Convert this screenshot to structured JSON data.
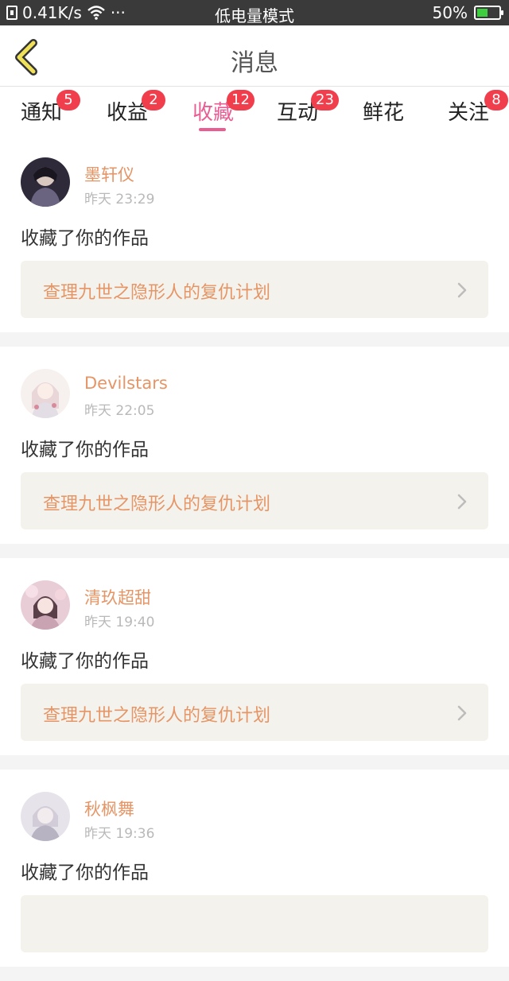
{
  "status_bar": {
    "speed": "0.41K/s",
    "more": "···",
    "mode": "低电量模式",
    "battery_percent": "50%",
    "battery_level": 0.5
  },
  "header": {
    "title": "消息",
    "back_icon": "chevron-left-icon",
    "accent_color": "#f0e15a"
  },
  "tabs": [
    {
      "label": "通知",
      "badge": "5",
      "active": false
    },
    {
      "label": "收益",
      "badge": "2",
      "active": false
    },
    {
      "label": "收藏",
      "badge": "12",
      "active": true
    },
    {
      "label": "互动",
      "badge": "23",
      "active": false
    },
    {
      "label": "鲜花",
      "badge": "",
      "active": false
    },
    {
      "label": "关注",
      "badge": "8",
      "active": false
    }
  ],
  "colors": {
    "active_tab": "#e95d93",
    "badge": "#f03e4d",
    "username": "#e59566",
    "work_bg": "#f3f2ec"
  },
  "messages": [
    {
      "user": "墨轩仪",
      "time": "昨天 23:29",
      "action": "收藏了你的作品",
      "work": "查理九世之隐形人的复仇计划"
    },
    {
      "user": "Devilstars",
      "time": "昨天 22:05",
      "action": "收藏了你的作品",
      "work": "查理九世之隐形人的复仇计划"
    },
    {
      "user": "清玖超甜",
      "time": "昨天 19:40",
      "action": "收藏了你的作品",
      "work": "查理九世之隐形人的复仇计划"
    },
    {
      "user": "秋枫舞",
      "time": "昨天 19:36",
      "action": "收藏了你的作品",
      "work": ""
    }
  ]
}
